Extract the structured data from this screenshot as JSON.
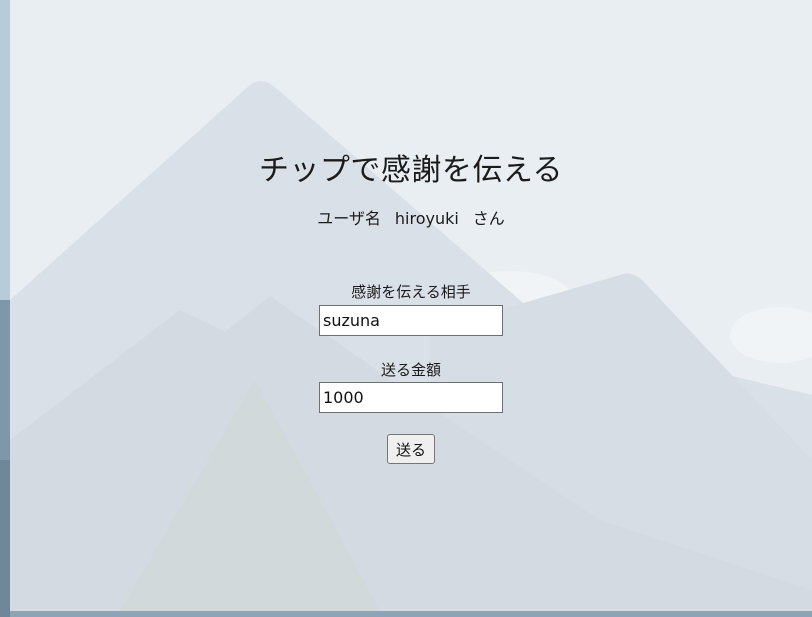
{
  "page": {
    "title": "チップで感謝を伝える"
  },
  "user": {
    "prefix": "ユーザ名",
    "name": "hiroyuki",
    "suffix": "さん"
  },
  "form": {
    "recipient_label": "感謝を伝える相手",
    "recipient_value": "suzuna",
    "amount_label": "送る金額",
    "amount_value": "1000",
    "submit_label": "送る"
  },
  "background": {
    "image": "mountain-landscape"
  }
}
